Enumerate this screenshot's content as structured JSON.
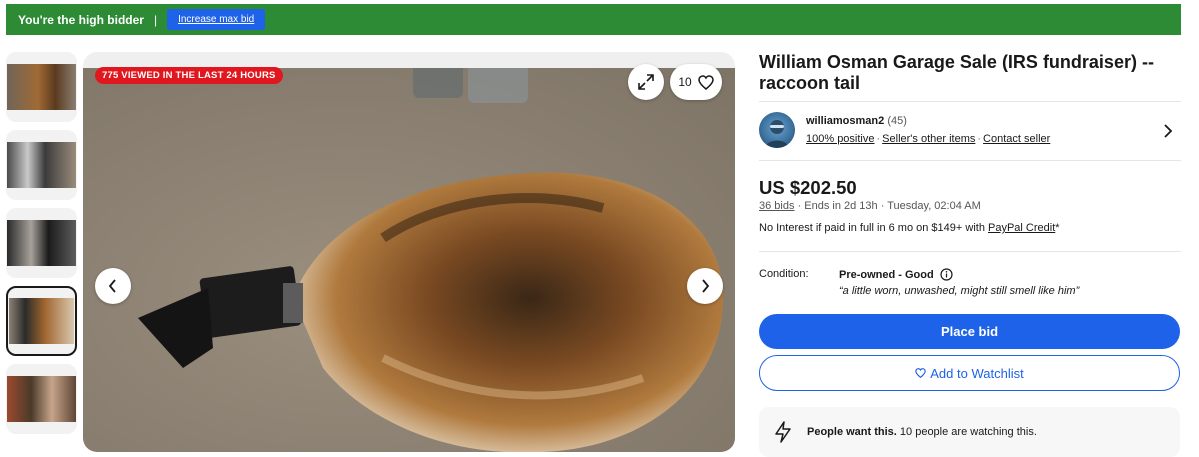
{
  "banner": {
    "message": "You're the high bidder",
    "separator": "|",
    "increase_label": "Increase max bid"
  },
  "gallery": {
    "thumbnails": [
      {
        "alt": "tail thumbnail 1",
        "selected": false
      },
      {
        "alt": "tail thumbnail 2",
        "selected": false
      },
      {
        "alt": "tail thumbnail 3",
        "selected": false
      },
      {
        "alt": "tail thumbnail 4",
        "selected": true
      },
      {
        "alt": "tail thumbnail 5",
        "selected": false
      }
    ],
    "viewed_badge": "775 VIEWED IN THE LAST 24 HOURS",
    "watch_count": "10"
  },
  "listing": {
    "title": "William Osman Garage Sale (IRS fundraiser) -- raccoon tail",
    "seller": {
      "name": "williamosman2",
      "feedback": "(45)",
      "positive": "100% positive",
      "other_items": "Seller's other items",
      "contact": "Contact seller"
    },
    "price": "US $202.50",
    "bids_link": "36 bids",
    "ends": "Ends in 2d 13h · Tuesday, 02:04 AM",
    "credit_prefix": "No Interest if paid in full in 6 mo on $149+ with ",
    "credit_link": "PayPal Credit",
    "credit_suffix": "*",
    "condition_label": "Condition:",
    "condition_value": "Pre-owned - Good",
    "condition_note": "“a little worn, unwashed, might still smell like him”",
    "place_bid": "Place bid",
    "watchlist": "Add to Watchlist",
    "promo_bold": "People want this.",
    "promo_text": " 10 people are watching this."
  },
  "colors": {
    "banner_green": "#2d8b35",
    "primary_blue": "#1d62e8",
    "badge_red": "#e0171f"
  },
  "icons": [
    "expand-icon",
    "heart-icon",
    "chevron-left-icon",
    "chevron-right-icon",
    "info-icon",
    "lightning-icon"
  ]
}
